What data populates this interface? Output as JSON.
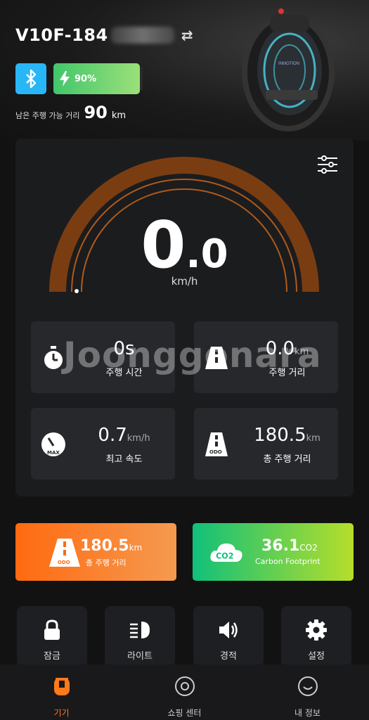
{
  "device": {
    "name_prefix": "V10F-184",
    "battery_percent": 90,
    "battery_label": "90%",
    "range_label": "남은 주행 가능 거리",
    "range_value": "90",
    "range_unit": "km",
    "wheel_brand": "INMOTION"
  },
  "gauge": {
    "speed_int": "0",
    "speed_dec": ".0",
    "unit": "km/h"
  },
  "cards": [
    {
      "value": "0s",
      "unit": "",
      "label": "주행 시간"
    },
    {
      "value": "0.0",
      "unit": "km",
      "label": "주행 거리"
    },
    {
      "value": "0.7",
      "unit": "km/h",
      "label": "최고 속도",
      "icon_text": "MAX"
    },
    {
      "value": "180.5",
      "unit": "km",
      "label": "총 주행 거리",
      "icon_text": "ODO"
    }
  ],
  "watermark": "Joonggonara",
  "stats": {
    "odo": {
      "value": "180.5",
      "unit": "km",
      "label": "총 주행 거리",
      "icon_text": "ODO"
    },
    "carbon": {
      "value": "36.1",
      "unit": "CO2",
      "label": "Carbon Footprint",
      "icon_text": "CO2"
    }
  },
  "tiles": [
    {
      "label": "잠금"
    },
    {
      "label": "라이트"
    },
    {
      "label": "경적"
    },
    {
      "label": "설정"
    }
  ],
  "tabs": [
    {
      "label": "기기"
    },
    {
      "label": "쇼핑 센터"
    },
    {
      "label": "내 정보"
    }
  ],
  "colors": {
    "accent": "#ff7a1a",
    "gauge_arc": "#7a3d12",
    "bluetooth": "#29b6f6",
    "battery": "#42c66b"
  }
}
